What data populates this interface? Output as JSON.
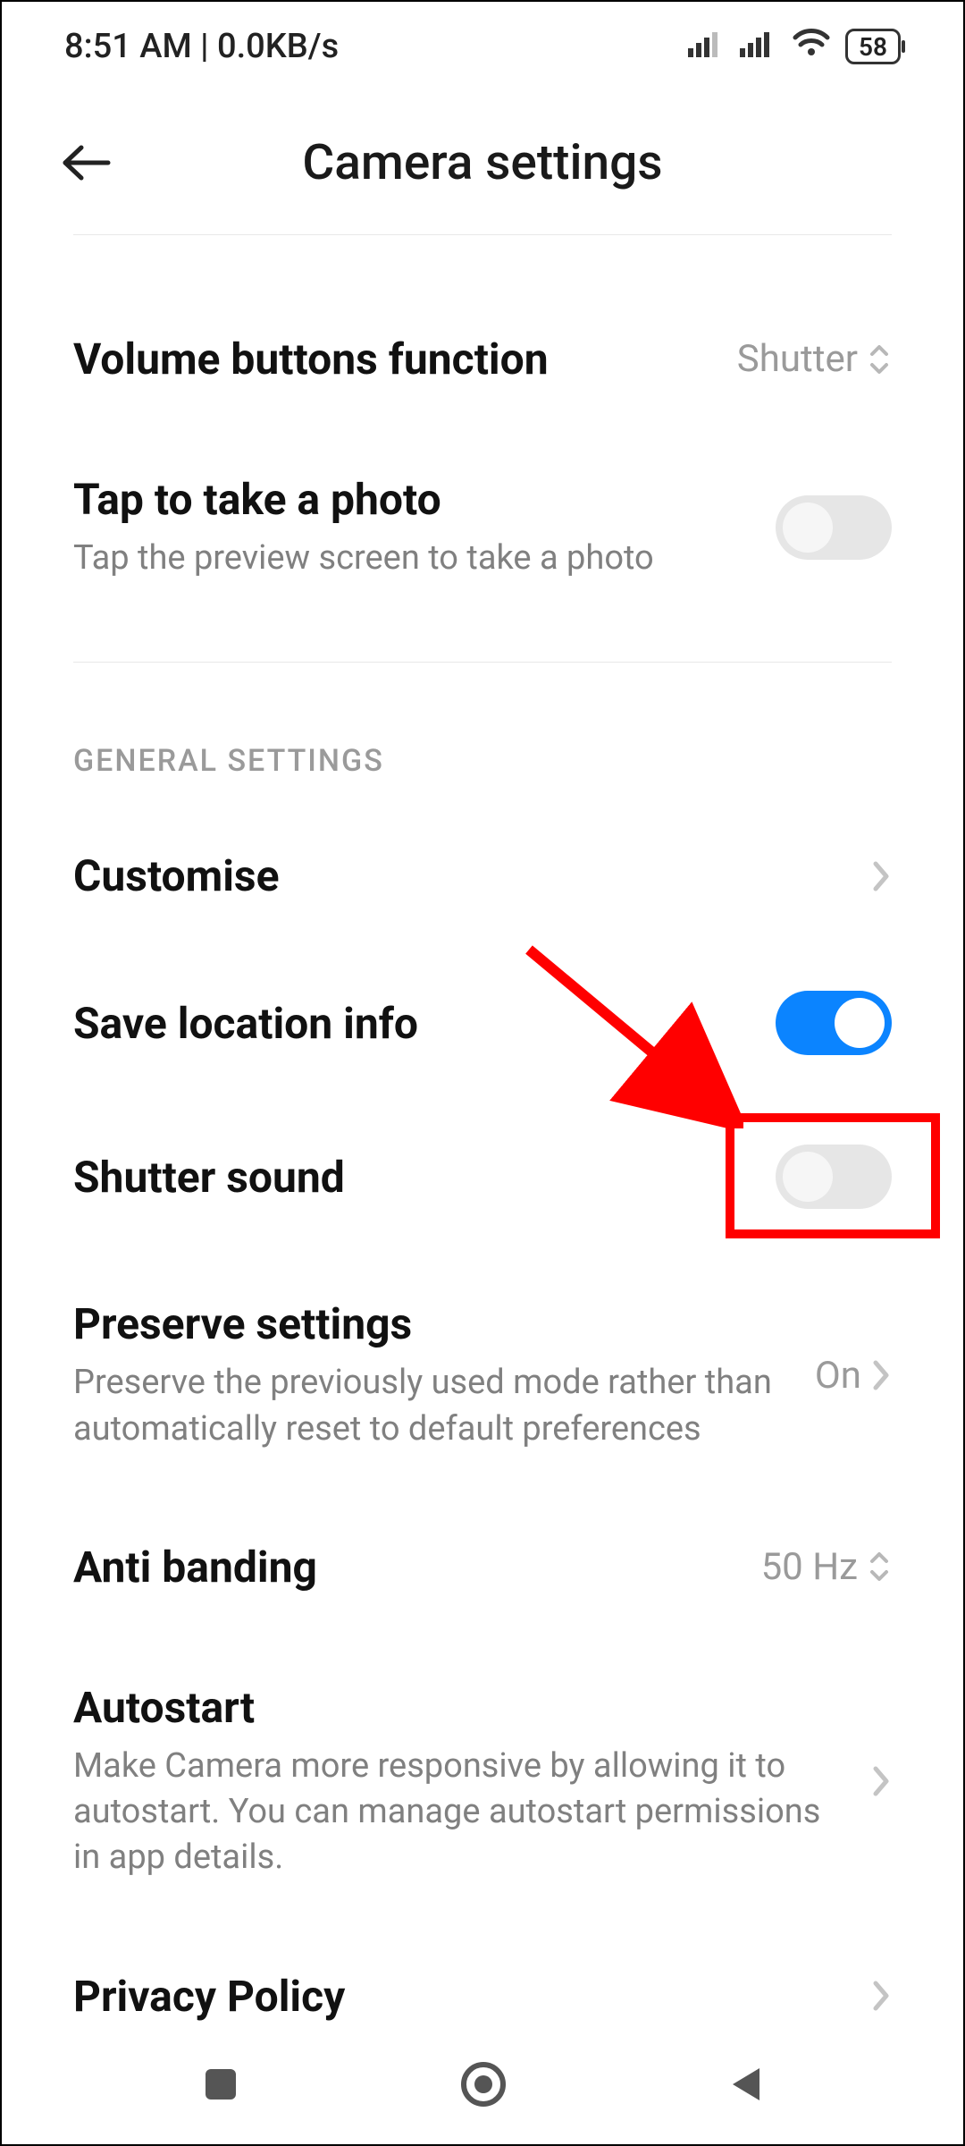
{
  "status": {
    "time": "8:51 AM",
    "speed": "0.0KB/s",
    "battery": "58"
  },
  "header": {
    "title": "Camera settings"
  },
  "rows": {
    "volume_buttons": {
      "title": "Volume buttons function",
      "value": "Shutter"
    },
    "tap_photo": {
      "title": "Tap to take a photo",
      "subtitle": "Tap the preview screen to take a photo"
    },
    "customise": {
      "title": "Customise"
    },
    "save_location": {
      "title": "Save location info"
    },
    "shutter_sound": {
      "title": "Shutter sound"
    },
    "preserve": {
      "title": "Preserve settings",
      "subtitle": "Preserve the previously used mode rather than automatically reset to default preferences",
      "value": "On"
    },
    "anti_banding": {
      "title": "Anti banding",
      "value": "50 Hz"
    },
    "autostart": {
      "title": "Autostart",
      "subtitle": "Make Camera more responsive by allowing it to autostart. You can manage autostart permissions in app details."
    },
    "privacy": {
      "title": "Privacy Policy"
    }
  },
  "section": {
    "general": "GENERAL SETTINGS"
  },
  "annotation": {
    "target": "shutter-sound-toggle"
  }
}
